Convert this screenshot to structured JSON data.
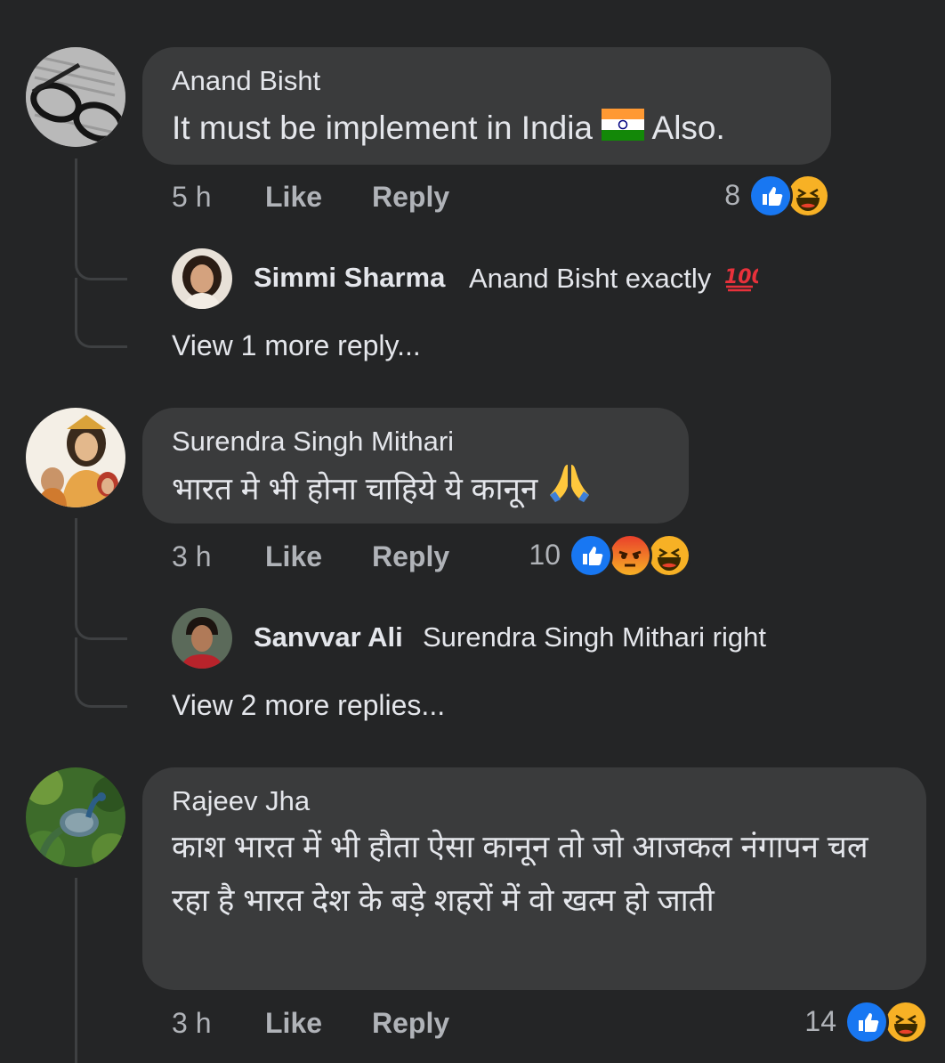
{
  "comments": [
    {
      "author": "Anand Bisht",
      "text_before": "It must be implement in India",
      "flag_icon": "india-flag-icon",
      "text_after": "Also.",
      "time": "5 h",
      "like_label": "Like",
      "reply_label": "Reply",
      "reaction_count": "8",
      "reactions": [
        "like",
        "haha"
      ],
      "replies": [
        {
          "author": "Simmi Sharma",
          "text": "Anand Bisht exactly",
          "emoji": "hundred-points-icon"
        }
      ],
      "more_replies": "View 1 more reply..."
    },
    {
      "author": "Surendra Singh Mithari",
      "text": "भारत मे भी होना चाहिये ये कानून",
      "emoji": "folded-hands-icon",
      "time": "3 h",
      "like_label": "Like",
      "reply_label": "Reply",
      "reaction_count": "10",
      "reactions": [
        "like",
        "angry",
        "haha"
      ],
      "replies": [
        {
          "author": "Sanvvar Ali",
          "text": "Surendra Singh Mithari right"
        }
      ],
      "more_replies": "View 2 more replies..."
    },
    {
      "author": "Rajeev Jha",
      "text": "काश भारत में भी हौता ऐसा कानून तो जो आजकल नंगापन चल रहा है भारत देश के बड़े शहरों में वो खत्म हो जाती",
      "time": "3 h",
      "like_label": "Like",
      "reply_label": "Reply",
      "reaction_count": "14",
      "reactions": [
        "like",
        "haha"
      ]
    }
  ],
  "colors": {
    "background": "#242526",
    "bubble": "#3a3b3c",
    "primary_text": "#e4e6eb",
    "secondary_text": "#b0b3b8",
    "like_blue": "#1877f2",
    "haha_yellow": "#f7b125",
    "angry_orange": "#e9710f"
  }
}
